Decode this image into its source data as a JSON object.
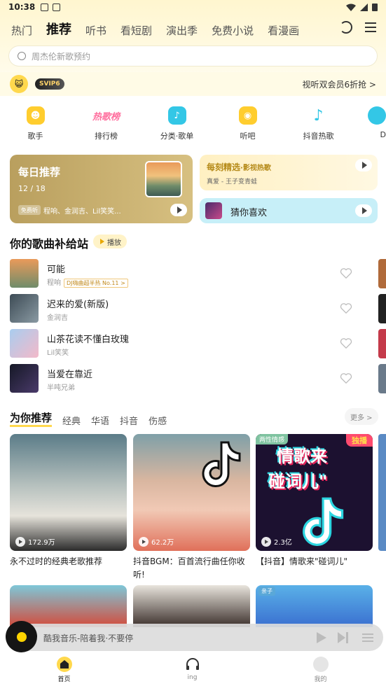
{
  "status": {
    "time": "10:38"
  },
  "nav": {
    "tabs": [
      "热门",
      "推荐",
      "听书",
      "看短剧",
      "演出季",
      "免费小说",
      "看漫画"
    ],
    "active": 1
  },
  "search": {
    "placeholder": "周杰伦新歌预约"
  },
  "vip": {
    "badge": "SVIP6",
    "offer": "视听双会员6折抢 >"
  },
  "quick": [
    {
      "label": "歌手",
      "icon": "singer-icon",
      "color": "#ffcd2e"
    },
    {
      "label": "排行榜",
      "icon": "rank-text-icon",
      "text": "热歌榜",
      "color": "#ff6f9e"
    },
    {
      "label": "分类·歌单",
      "icon": "category-icon",
      "color": "#33c7e6"
    },
    {
      "label": "听吧",
      "icon": "listen-icon",
      "color": "#ffcd2e"
    },
    {
      "label": "抖音热歌",
      "icon": "douyin-icon",
      "color": "#33c7e6"
    },
    {
      "label": "D",
      "icon": "dj-icon",
      "color": "#33c7e6"
    }
  ],
  "daily": {
    "title": "每日推荐",
    "date": "12 / 18",
    "free": "免费听",
    "artists": "程响、金润吉、Lil笑笑..."
  },
  "moment": {
    "title": "每刻精选",
    "subtitle": "·影视热歌",
    "song": "真爱 - 王子变青蛙"
  },
  "guess": {
    "title": "猜你喜欢"
  },
  "supply": {
    "title": "你的歌曲补给站",
    "play": "播放"
  },
  "songs": [
    {
      "name": "可能",
      "artist": "程响",
      "tag": "DJ嗨曲超半热 No.11 >",
      "cover": "#c9894f"
    },
    {
      "name": "迟来的爱(新版)",
      "artist": "金润吉",
      "tag": "",
      "cover": "#51606a"
    },
    {
      "name": "山茶花读不懂白玫瑰",
      "artist": "Lil笑笑",
      "tag": "",
      "cover": "#9bc3e8"
    },
    {
      "name": "当爱在靠近",
      "artist": "半吨兄弟",
      "tag": "",
      "cover": "#1a1d2c"
    }
  ],
  "recommend": {
    "tabs": [
      "为你推荐",
      "经典",
      "华语",
      "抖音",
      "伤感"
    ],
    "more": "更多 >"
  },
  "cards": [
    {
      "count": "172.9万",
      "caption": "永不过时的经典老歌推荐",
      "badge_l": "",
      "badge_r": "",
      "overlay": ""
    },
    {
      "count": "62.2万",
      "caption": "抖音BGM：百首流行曲任你收听!",
      "badge_l": "",
      "badge_r": "",
      "overlay": ""
    },
    {
      "count": "2.3亿",
      "caption": "【抖音】情歌来\"碰词儿\"",
      "badge_l": "两性情感",
      "badge_r": "独播",
      "overlay": "情歌来\n碰词儿\""
    }
  ],
  "row2": {
    "badge": "亲子"
  },
  "player": {
    "text": "酷我音乐-陪着我·不要停"
  },
  "bottomnav": [
    {
      "label": "首页"
    },
    {
      "label": "ing"
    },
    {
      "label": "我的"
    }
  ]
}
